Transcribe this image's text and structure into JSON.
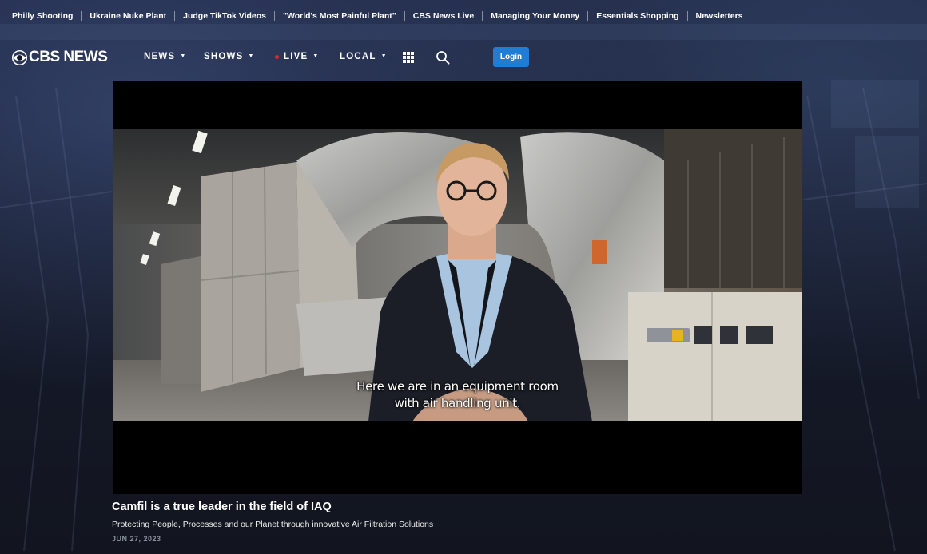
{
  "trending": [
    "Philly Shooting",
    "Ukraine Nuke Plant",
    "Judge TikTok Videos",
    "\"World's Most Painful Plant\"",
    "CBS News Live",
    "Managing Your Money",
    "Essentials Shopping",
    "Newsletters"
  ],
  "nav": {
    "logo_text": "CBS NEWS",
    "news": "NEWS",
    "shows": "SHOWS",
    "live": "LIVE",
    "local": "LOCAL",
    "login": "Login"
  },
  "video": {
    "subtitle_line1": "Here we are in an equipment room",
    "subtitle_line2": "with air handling unit."
  },
  "article": {
    "title": "Camfil is a true leader in the field of IAQ",
    "description": "Protecting People, Processes and our Planet through innovative Air Filtration Solutions",
    "date": "JUN 27, 2023"
  },
  "colors": {
    "login_button": "#1f7dd3",
    "live_dot": "#e8252b"
  }
}
